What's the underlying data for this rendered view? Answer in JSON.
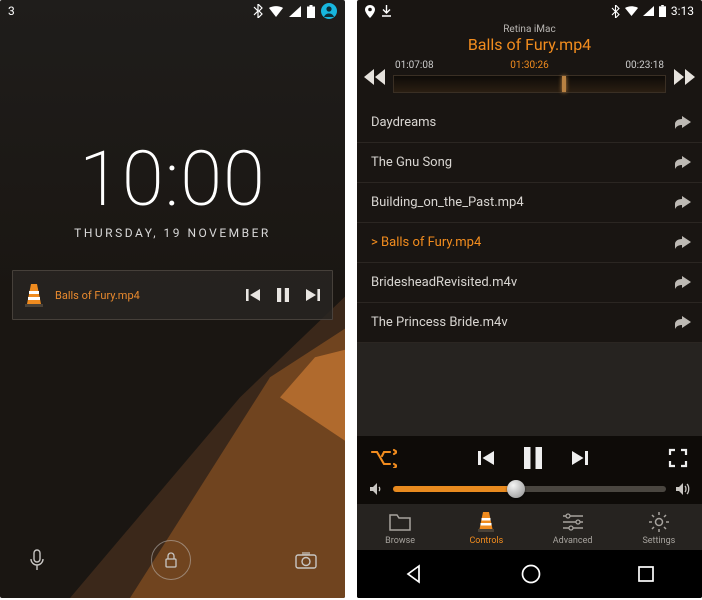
{
  "left": {
    "status": {
      "notification": "3"
    },
    "clock": "10:00",
    "date": "THURSDAY, 19 NOVEMBER",
    "media": {
      "title": "Balls of Fury.mp4"
    }
  },
  "right": {
    "status": {
      "time": "3:13"
    },
    "header": {
      "device": "Retina iMac",
      "title": "Balls of Fury.mp4"
    },
    "seek": {
      "elapsed": "01:07:08",
      "total": "01:30:26",
      "remaining": "00:23:18"
    },
    "playlist": [
      {
        "label": "Daydreams",
        "active": false
      },
      {
        "label": "The Gnu Song",
        "active": false
      },
      {
        "label": "Building_on_the_Past.mp4",
        "active": false
      },
      {
        "label": "> Balls of Fury.mp4",
        "active": true
      },
      {
        "label": "BridesheadRevisited.m4v",
        "active": false
      },
      {
        "label": "The Princess Bride.m4v",
        "active": false
      }
    ],
    "tabs": {
      "browse": "Browse",
      "controls": "Controls",
      "advanced": "Advanced",
      "settings": "Settings"
    }
  }
}
